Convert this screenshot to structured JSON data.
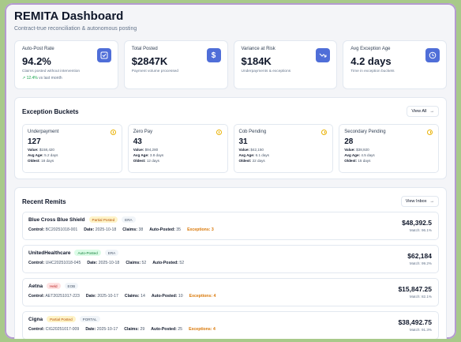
{
  "header": {
    "title": "REMITA Dashboard",
    "subtitle": "Contract-true reconciliation & autonomous posting"
  },
  "kpis": [
    {
      "label": "Auto-Post Rate",
      "value": "94.2%",
      "desc": "Claims posted without intervention",
      "trend": "↗ 12.4%",
      "trend_rest": "vs last month",
      "icon": "check-icon"
    },
    {
      "label": "Total Posted",
      "value": "$2847K",
      "desc": "Payment volume processed",
      "icon": "dollar-icon"
    },
    {
      "label": "Variance at Risk",
      "value": "$184K",
      "desc": "Underpayments & exceptions",
      "icon": "trend-down-icon"
    },
    {
      "label": "Avg Exception Age",
      "value": "4.2 days",
      "desc": "Time in exception buckets",
      "icon": "clock-icon"
    }
  ],
  "exceptions": {
    "title": "Exception Buckets",
    "view_all": "View All",
    "buckets": [
      {
        "name": "Underpayment",
        "count": "127",
        "value": "$158,420",
        "avg_age": "5.2 days",
        "oldest": "18 days"
      },
      {
        "name": "Zero Pay",
        "count": "43",
        "value": "$94,280",
        "avg_age": "3.8 days",
        "oldest": "12 days"
      },
      {
        "name": "Cob Pending",
        "count": "31",
        "value": "$42,150",
        "avg_age": "6.1 days",
        "oldest": "22 days"
      },
      {
        "name": "Secondary Pending",
        "count": "28",
        "value": "$38,920",
        "avg_age": "4.5 days",
        "oldest": "15 days"
      }
    ],
    "labels": {
      "value": "Value:",
      "avg_age": "Avg Age:",
      "oldest": "Oldest:"
    }
  },
  "remits": {
    "title": "Recent Remits",
    "view_inbox": "View Inbox",
    "labels": {
      "control": "Control:",
      "date": "Date:",
      "claims": "Claims:",
      "auto": "Auto-Posted:",
      "exceptions": "Exceptions:"
    },
    "items": [
      {
        "payer": "Blue Cross Blue Shield",
        "status": "Partial Posted",
        "status_class": "b-partial",
        "type": "ERA",
        "control": "BC20251018-001",
        "date": "2025-10-18",
        "claims": "38",
        "auto": "35",
        "exceptions": "3",
        "amount": "$48,392.5",
        "match": "Match: 96.1%"
      },
      {
        "payer": "UnitedHealthcare",
        "status": "Auto-Posted",
        "status_class": "b-auto",
        "type": "ERA",
        "control": "UHC20251018-045",
        "date": "2025-10-18",
        "claims": "52",
        "auto": "52",
        "exceptions": "",
        "amount": "$62,184",
        "match": "Match: 99.2%"
      },
      {
        "payer": "Aetna",
        "status": "Held",
        "status_class": "b-held",
        "type": "EOB",
        "control": "AET20251017-223",
        "date": "2025-10-17",
        "claims": "14",
        "auto": "10",
        "exceptions": "4",
        "amount": "$15,847.25",
        "match": "Match: 82.1%"
      },
      {
        "payer": "Cigna",
        "status": "Partial Posted",
        "status_class": "b-partial",
        "type": "PORTAL",
        "control": "CIG20251017-009",
        "date": "2025-10-17",
        "claims": "29",
        "auto": "25",
        "exceptions": "4",
        "amount": "$38,492.75",
        "match": "Match: 91.3%"
      }
    ]
  }
}
